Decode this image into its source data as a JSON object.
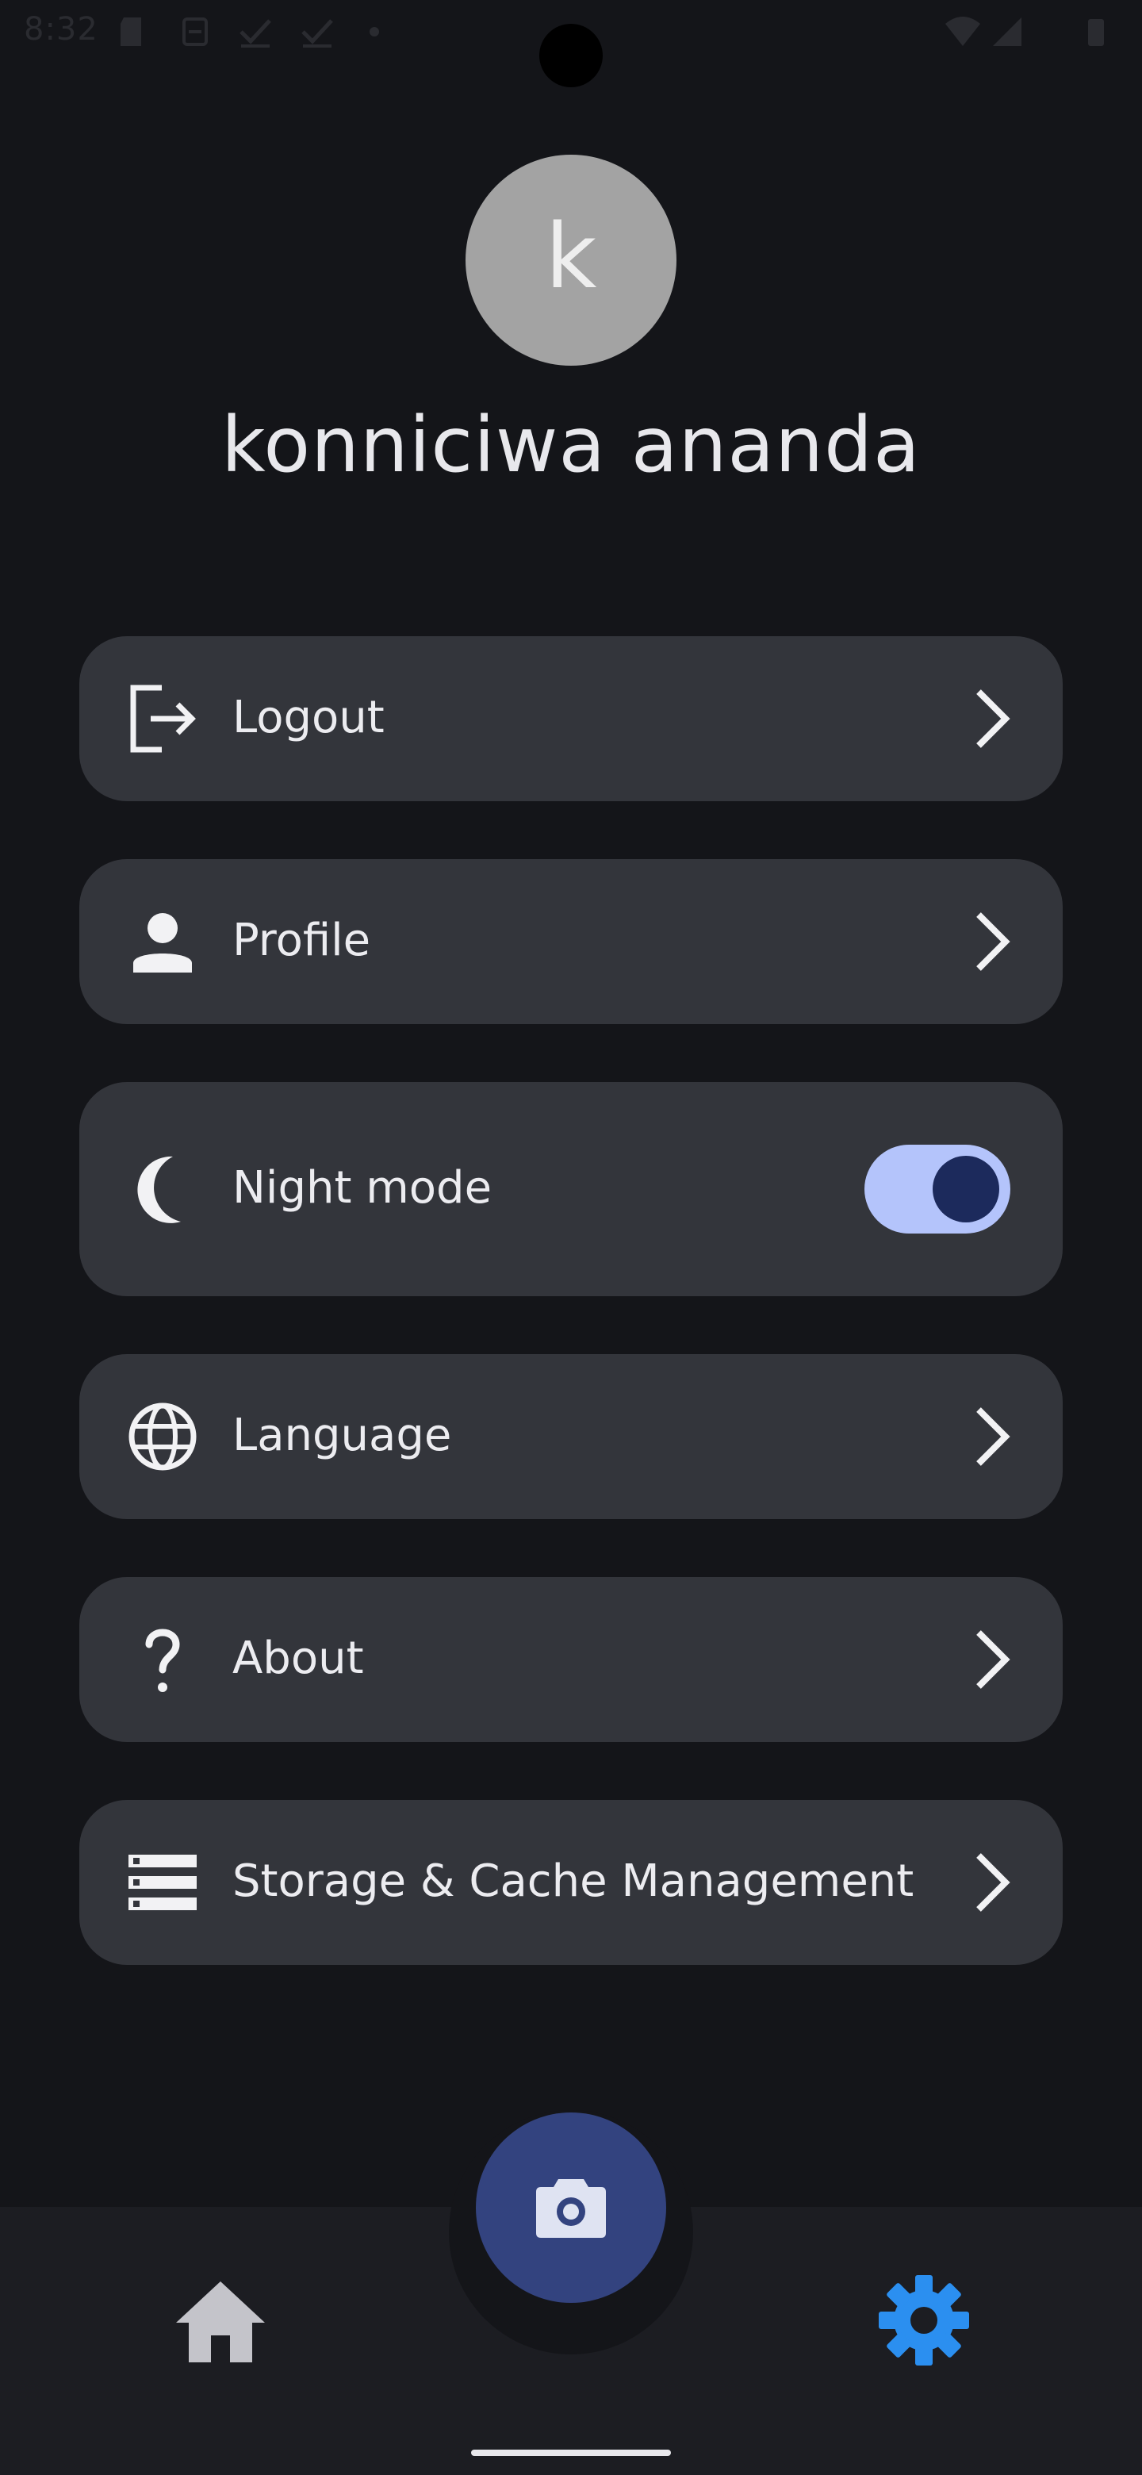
{
  "status_bar": {
    "time": "8:32",
    "icons": [
      "sd-card-icon",
      "sync-icon",
      "check-icon",
      "check-icon",
      "dot-icon",
      "wifi-icon",
      "signal-icon",
      "battery-icon"
    ]
  },
  "profile": {
    "avatar_letter": "k",
    "name": "konniciwa ananda",
    "avatar_color": "#a3a3a3"
  },
  "settings": {
    "items": [
      {
        "label": "Logout",
        "icon": "logout-icon",
        "action": "chevron-right-icon"
      },
      {
        "label": "Profile",
        "icon": "person-icon",
        "action": "chevron-right-icon"
      },
      {
        "label": "Night mode",
        "icon": "moon-icon",
        "action": "toggle",
        "enabled": true
      },
      {
        "label": "Language",
        "icon": "globe-icon",
        "action": "chevron-right-icon"
      },
      {
        "label": "About",
        "icon": "question-mark-icon",
        "action": "chevron-right-icon"
      },
      {
        "label": "Storage & Cache Management",
        "icon": "storage-icon",
        "action": "chevron-right-icon"
      }
    ]
  },
  "bottom_nav": {
    "items": [
      {
        "icon": "home-icon",
        "active": false
      },
      {
        "icon": "camera-icon",
        "active": false
      },
      {
        "icon": "gear-icon",
        "active": true
      }
    ]
  },
  "colors": {
    "background": "#141519",
    "card": "#33353b",
    "toggle_track": "#b4c4fb",
    "toggle_knob": "#1c2a5c",
    "fab": "#33437f",
    "active_nav": "#2b8ff0",
    "inactive_nav": "#c4c4ca"
  }
}
